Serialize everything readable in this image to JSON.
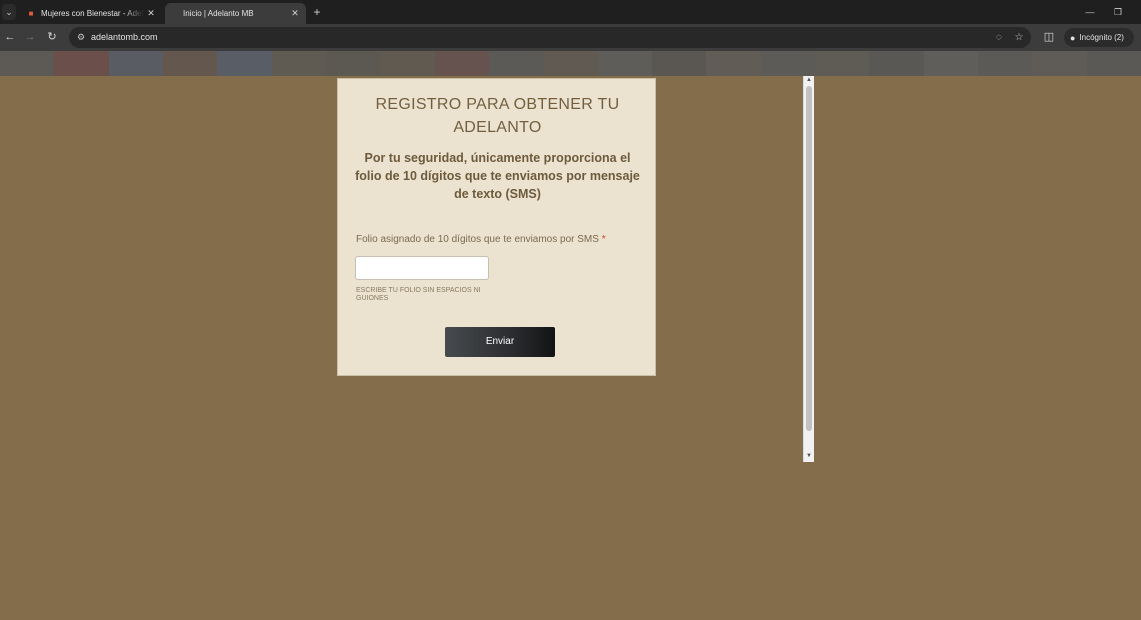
{
  "browser": {
    "tabs": [
      {
        "title": "Mujeres con Bienestar - Adelanto",
        "active": false
      },
      {
        "title": "Inicio | Adelanto MB",
        "active": true
      }
    ],
    "url": "adelantomb.com",
    "incognito_label": "Incógnito (2)",
    "icons": {
      "tab_search": "chevron-down-icon",
      "close": "close-icon",
      "new_tab": "plus-icon",
      "back": "arrow-left-icon",
      "forward": "arrow-right-icon",
      "reload": "reload-icon",
      "site_info": "tune-icon",
      "eye_off": "eye-off-icon",
      "bookmark": "star-icon",
      "side_panel": "side-panel-icon",
      "incognito": "incognito-icon",
      "minimize": "minimize-icon",
      "restore": "restore-icon"
    }
  },
  "form": {
    "title": "REGISTRO PARA OBTENER TU ADELANTO",
    "subtitle": "Por tu seguridad, únicamente proporciona el folio de 10 dígitos que te enviamos por mensaje de texto (SMS)",
    "field_label": "Folio asignado de 10 dígitos que te enviamos por SMS",
    "required_mark": "*",
    "field_value": "",
    "helper_text": "ESCRIBE TU FOLIO SIN ESPACIOS NI GUIONES",
    "submit_label": "Enviar"
  },
  "colors": {
    "page_background": "#846d4a",
    "card_background": "#ebe3d0",
    "title_color": "#735f3f",
    "required_color": "#d23b3b",
    "button_dark": "#121314"
  }
}
